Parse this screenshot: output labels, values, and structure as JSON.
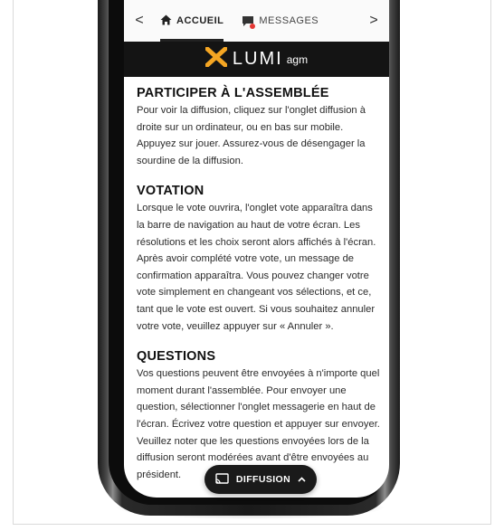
{
  "nav": {
    "prev_label": "<",
    "next_label": ">",
    "tabs": [
      {
        "label": "ACCUEIL",
        "icon": "home-icon",
        "active": true
      },
      {
        "label": "MESSAGES",
        "icon": "message-icon",
        "badge": true
      }
    ]
  },
  "brand": {
    "name": "LUMI",
    "suffix": "agm",
    "logo_color": "#f5a623"
  },
  "sections": [
    {
      "heading": "PARTICIPER À L'ASSEMBLÉE",
      "body": "Pour voir la diffusion, cliquez sur l'onglet diffusion à droite sur un ordinateur, ou en bas sur mobile. Appuyez sur jouer. Assurez-vous de désengager la sourdine de la diffusion."
    },
    {
      "heading": "VOTATION",
      "body": "Lorsque le vote ouvrira, l'onglet vote apparaîtra dans la barre de navigation au haut de votre écran. Les résolutions et les choix seront alors affichés à l'écran. Après avoir complété votre vote, un message de confirmation apparaîtra. Vous pouvez changer votre vote simplement en changeant vos sélections, et ce, tant que le vote est ouvert. Si vous souhaitez annuler votre vote, veuillez appuyer sur « Annuler »."
    },
    {
      "heading": "QUESTIONS",
      "body": "Vos questions peuvent être envoyées à n'importe quel moment durant l'assemblée. Pour envoyer une question, sélectionner l'onglet messagerie en haut de l'écran. Écrivez votre question et appuyer sur envoyer. Veuillez noter que les questions envoyées lors de la diffusion seront modérées avant d'être envoyées au président."
    }
  ],
  "broadcast_button": {
    "label": "DIFFUSION",
    "icon": "cast-icon",
    "chevron": "chevron-up-icon"
  }
}
